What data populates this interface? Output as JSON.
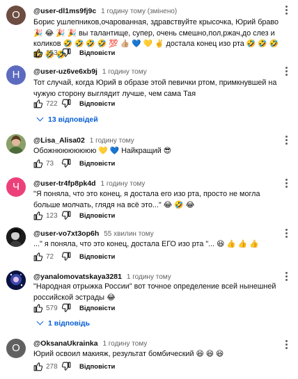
{
  "comments": [
    {
      "author": "@user-dl1ms9fj9c",
      "time": "1 годину тому (змінено)",
      "avatar_letter": "О",
      "avatar_color": "#6d4c41",
      "text": "Борис ушлепников,очарованная, здравствуйте крысочка, Юрий браво 🎉 😂 🎉 🎉 вы талантище, супер, очень смешно,пол,ржач,до слез и коликов 🤣 🤣 🤣 🤣 💯 👍🏼 💙 💛 ✌️ достала конец изо рта 🤣 🤣 🤣 🤣 🤣 🤣",
      "likes": "153",
      "reply_label": "Відповісти"
    },
    {
      "author": "@user-uz6ve6xb9j",
      "time": "1 годину тому",
      "avatar_letter": "Н",
      "avatar_color": "#5c6bc0",
      "text": "Тот случай, когда Юрий в образе этой певички ртом, примкнувшей на чужую сторону выглядит лучше, чем сама Тая",
      "likes": "722",
      "reply_label": "Відповісти",
      "replies_label": "13 відповідей"
    },
    {
      "author": "@Lisa_Alisa02",
      "time": "1 годину тому",
      "avatar_letter": "",
      "avatar_color": "#7a8c5a",
      "text": "Обожнююююююю 💛 💙 Найкращий 😎",
      "likes": "73",
      "reply_label": "Відповісти"
    },
    {
      "author": "@user-tr4fp8pk4d",
      "time": "1 годину тому",
      "avatar_letter": "Ч",
      "avatar_color": "#ec407a",
      "text": "\"Я поняла, что это конец, я достала его изо рта, просто не могла больше молчать, глядя на всё это...\" 😂 🤣 😂",
      "likes": "123",
      "reply_label": "Відповісти"
    },
    {
      "author": "@user-vo7xt3op6h",
      "time": "55 хвилин тому",
      "avatar_letter": "",
      "avatar_color": "#212121",
      "text": "...\" я поняла, что это конец, достала ЕГО изо рта \"... 😆 👍 👍 👍",
      "likes": "72",
      "reply_label": "Відповісти"
    },
    {
      "author": "@yanalomovatskaya3281",
      "time": "1 годину тому",
      "avatar_letter": "",
      "avatar_color": "#1a237e",
      "text": "\"Народная отрыжка России\" вот точное определение всей нынешней российской эстрады 😂",
      "likes": "579",
      "reply_label": "Відповісти",
      "replies_label": "1 відповідь"
    },
    {
      "author": "@OksanaUkrainka",
      "time": "1 годину тому",
      "avatar_letter": "О",
      "avatar_color": "#616161",
      "text": "Юрий освоил макияж, результат бомбический 😆 😆 😆",
      "likes": "278",
      "reply_label": "Відповісти"
    }
  ]
}
